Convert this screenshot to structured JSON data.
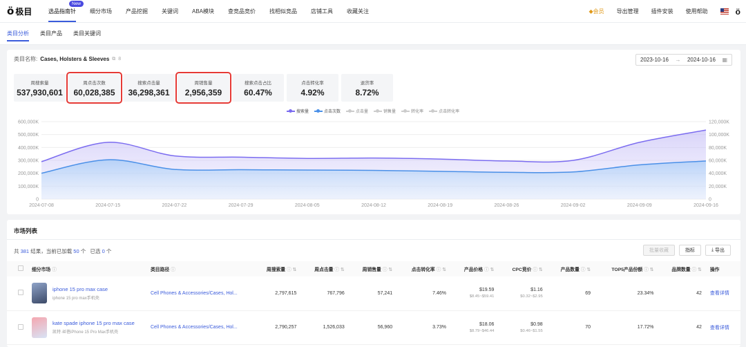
{
  "nav": {
    "logo_mark": "ö",
    "logo_text": "极目",
    "items": [
      "选品指南针",
      "细分市场",
      "产品挖掘",
      "关键词",
      "ABA模块",
      "查竞品竞价",
      "找相似竞品",
      "店铺工具",
      "收藏关注"
    ],
    "new_badge": "New",
    "right": {
      "vip": "◆会员",
      "export": "导出管理",
      "plugin": "插件安装",
      "help": "使用帮助"
    },
    "logo_small": "ö"
  },
  "subtabs": [
    "类目分析",
    "类目产品",
    "类目关键词"
  ],
  "category": {
    "label": "类目名称:",
    "value": "Cases, Holsters & Sleeves",
    "copy_icon": "⧉",
    "id_icon": "8"
  },
  "date_range": {
    "start": "2023-10-16",
    "arrow": "→",
    "end": "2024-10-16",
    "calendar_icon": "▦"
  },
  "metrics": [
    {
      "label": "周搜索量",
      "value": "537,930,601",
      "highlight": false
    },
    {
      "label": "周点击次数",
      "value": "60,028,385",
      "highlight": true
    },
    {
      "label": "搜索点击量",
      "value": "36,298,361",
      "highlight": false
    },
    {
      "label": "周销售量",
      "value": "2,956,359",
      "highlight": true
    },
    {
      "label": "搜索点击占比",
      "value": "60.47%",
      "highlight": false
    },
    {
      "label": "点击转化率",
      "value": "4.92%",
      "highlight": false
    },
    {
      "label": "退货率",
      "value": "8.72%",
      "highlight": false
    }
  ],
  "legend": [
    {
      "label": "搜索量",
      "color": "#7b6cf0"
    },
    {
      "label": "点击次数",
      "color": "#4a90e8"
    },
    {
      "label": "点击量",
      "color": "#cccccc"
    },
    {
      "label": "销售量",
      "color": "#cccccc"
    },
    {
      "label": "转化率",
      "color": "#cccccc"
    },
    {
      "label": "点击转化率",
      "color": "#cccccc"
    }
  ],
  "chart_data": {
    "type": "area",
    "x": [
      "2024-07-08",
      "2024-07-15",
      "2024-07-22",
      "2024-07-29",
      "2024-08-05",
      "2024-08-12",
      "2024-08-19",
      "2024-08-26",
      "2024-09-02",
      "2024-09-09",
      "2024-09-16"
    ],
    "y_left_ticks": [
      "0",
      "100,000K",
      "200,000K",
      "300,000K",
      "400,000K",
      "500,000K",
      "600,000K"
    ],
    "y_right_ticks": [
      "0",
      "20,000K",
      "40,000K",
      "60,000K",
      "80,000K",
      "100,000K",
      "120,000K"
    ],
    "ylim_left": [
      0,
      600000
    ],
    "ylim_right": [
      0,
      120000
    ],
    "series": [
      {
        "name": "搜索量",
        "axis": "left",
        "color": "#7b6cf0",
        "values": [
          290000,
          440000,
          335000,
          325000,
          315000,
          318000,
          310000,
          295000,
          300000,
          440000,
          535000
        ]
      },
      {
        "name": "点击次数",
        "axis": "right",
        "color": "#4a90e8",
        "values": [
          40000,
          61000,
          46000,
          45500,
          45000,
          44500,
          43000,
          41500,
          42000,
          53000,
          59000
        ]
      }
    ]
  },
  "market": {
    "title": "市场列表",
    "summary_prefix": "共",
    "total": "381",
    "summary_mid": "结果，当前已加载",
    "loaded": "50",
    "summary_unit": "个",
    "selected_prefix": "已选",
    "selected": "0",
    "selected_unit": "个",
    "buttons": {
      "batch": "批量收藏",
      "metrics": "指标",
      "export": "导出"
    }
  },
  "table": {
    "headers": [
      "细分市场",
      "类目路径",
      "周搜索量",
      "周点击量",
      "周销售量",
      "点击转化率",
      "产品价格",
      "CPC竞价",
      "产品数量",
      "TOP5产品份额",
      "品牌数量",
      "操作"
    ],
    "rows": [
      {
        "name": "iphone 15 pro max case",
        "sub": "iphone 15 pro max手机壳",
        "path": "Cell Phones & Accessories/Cases, Hol...",
        "search": "2,797,615",
        "click": "767,796",
        "sales": "57,241",
        "conv": "7.46%",
        "price": "$19.59",
        "price_range": "$8.45~$59.41",
        "cpc": "$1.16",
        "cpc_range": "$0.32~$2.95",
        "products": "69",
        "top5": "23.34%",
        "brands": "42",
        "action": "查看详情"
      },
      {
        "name": "kate spade iphone 15 pro max case",
        "sub": "凯特·丝蓓iPhone 15 Pro Max手机壳",
        "path": "Cell Phones & Accessories/Cases, Hol...",
        "search": "2,790,257",
        "click": "1,526,033",
        "sales": "56,960",
        "conv": "3.73%",
        "price": "$18.06",
        "price_range": "$8.79~$46.44",
        "cpc": "$0.98",
        "cpc_range": "$0.46~$1.55",
        "products": "70",
        "top5": "17.72%",
        "brands": "42",
        "action": "查看详情"
      }
    ]
  }
}
